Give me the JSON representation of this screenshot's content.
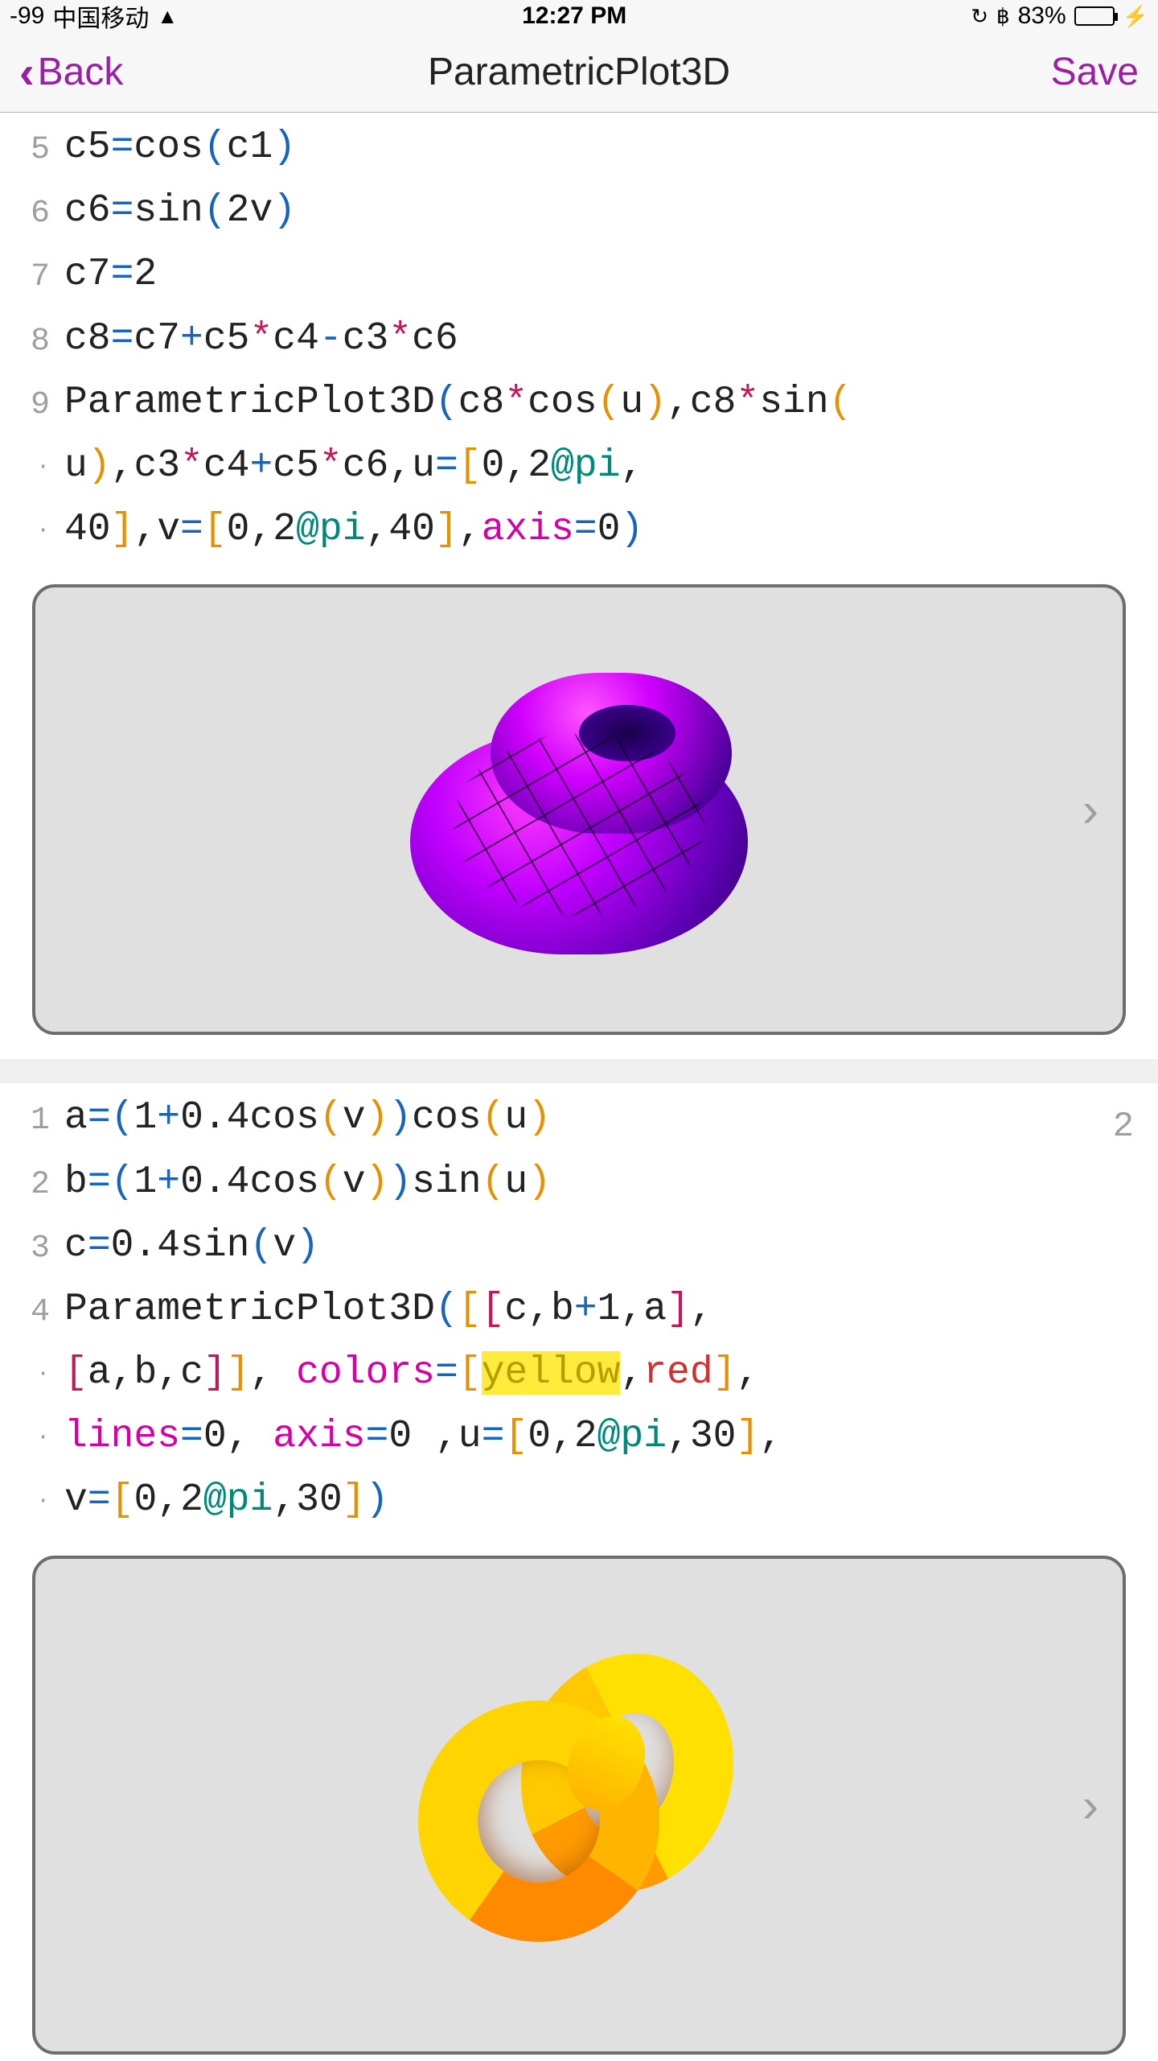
{
  "status": {
    "signal": "-99",
    "carrier": "中国移动",
    "time": "12:27 PM",
    "battery_pct": "83%",
    "battery_fill_pct": 83
  },
  "nav": {
    "back": "Back",
    "title": "ParametricPlot3D",
    "save": "Save"
  },
  "block1": {
    "line5_gutter": "5",
    "line5": {
      "a": "c5",
      "b": "=",
      "c": "cos",
      "d": "(",
      "e": "c1",
      "f": ")"
    },
    "line6_gutter": "6",
    "line6": {
      "a": "c6",
      "b": "=",
      "c": "sin",
      "d": "(",
      "e": "2v",
      "f": ")"
    },
    "line7_gutter": "7",
    "line7": {
      "a": "c7",
      "b": "=",
      "c": "2"
    },
    "line8_gutter": "8",
    "line8": {
      "a": "c8",
      "b": "=",
      "c": "c7",
      "d": "+",
      "e": "c5",
      "f": "*",
      "g": "c4",
      "h": "-",
      "i": "c3",
      "j": "*",
      "k": "c6"
    },
    "line9_gutter": "9",
    "dot": "·",
    "l9a": {
      "fn": "ParametricPlot3D",
      "p1": "(",
      "a": "c8",
      "st": "*",
      "cos": "cos",
      "p2": "(",
      "u": "u",
      "p3": ")",
      "co": ",",
      "b": "c8",
      "st2": "*",
      "sin": "sin",
      "p4": "("
    },
    "l9b": {
      "u": "u",
      "p1": ")",
      "co": ",",
      "a": "c3",
      "st": "*",
      "b": "c4",
      "pl": "+",
      "c": "c5",
      "st2": "*",
      "d": "c6",
      "co2": ",",
      "uu": "u",
      "eq": "=",
      "br1": "[",
      "z": "0",
      "co3": ",",
      "two": "2",
      "at": "@pi",
      "co4": ","
    },
    "l9c": {
      "n": "40",
      "br": "]",
      "co": ",",
      "v": "v",
      "eq": "=",
      "br1": "[",
      "z": "0",
      "co2": ",",
      "two": "2",
      "at": "@pi",
      "co3": ",",
      "n2": "40",
      "br2": "]",
      "co4": ",",
      "ax": "axis",
      "eq2": "=",
      "z2": "0",
      "p": ")"
    }
  },
  "block2": {
    "badge": "2",
    "g1": "1",
    "g2": "2",
    "g3": "3",
    "g4": "4",
    "dot": "·",
    "l1": {
      "a": "a",
      "eq": "=",
      "p1": "(",
      "one": "1",
      "pl": "+",
      "pt4": "0.4",
      "cos": "cos",
      "p2": "(",
      "v": "v",
      "p3": ")",
      "p4": ")",
      "cos2": "cos",
      "p5": "(",
      "u": "u",
      "p6": ")"
    },
    "l2": {
      "b": "b",
      "eq": "=",
      "p1": "(",
      "one": "1",
      "pl": "+",
      "pt4": "0.4",
      "cos": "cos",
      "p2": "(",
      "v": "v",
      "p3": ")",
      "p4": ")",
      "sin": "sin",
      "p5": "(",
      "u": "u",
      "p6": ")"
    },
    "l3": {
      "c": "c",
      "eq": "=",
      "pt4": "0.4",
      "sin": "sin",
      "p1": "(",
      "v": "v",
      "p2": ")"
    },
    "l4a": {
      "fn": "ParametricPlot3D",
      "p1": "(",
      "br1": "[",
      "br2": "[",
      "c": "c",
      "co": ",",
      "b": "b",
      "pl": "+",
      "one": "1",
      "co2": ",",
      "a": "a",
      "br3": "]",
      "co3": ","
    },
    "l4b": {
      "br1": "[",
      "a": "a",
      "co": ",",
      "b": "b",
      "co2": ",",
      "c": "c",
      "br2": "]",
      "br3": "]",
      "co3": ",",
      "sp": " ",
      "col": "colors",
      "eq": "=",
      "br4": "[",
      "yel": "yellow",
      "co4": ",",
      "red": "red",
      "br5": "]",
      "co5": ","
    },
    "l4c": {
      "ln": "lines",
      "eq": "=",
      "z": "0",
      "co": ",",
      "sp": " ",
      "ax": "axis",
      "eq2": "=",
      "z2": "0",
      "sp2": " ",
      "co2": ",",
      "u": "u",
      "eq3": "=",
      "br1": "[",
      "z3": "0",
      "co3": ",",
      "two": "2",
      "at": "@pi",
      "co4": ",",
      "n": "30",
      "br2": "]",
      "co5": ","
    },
    "l4d": {
      "v": "v",
      "eq": "=",
      "br1": "[",
      "z": "0",
      "co": ",",
      "two": "2",
      "at": "@pi",
      "co2": ",",
      "n": "30",
      "br2": "]",
      "p": ")"
    }
  }
}
